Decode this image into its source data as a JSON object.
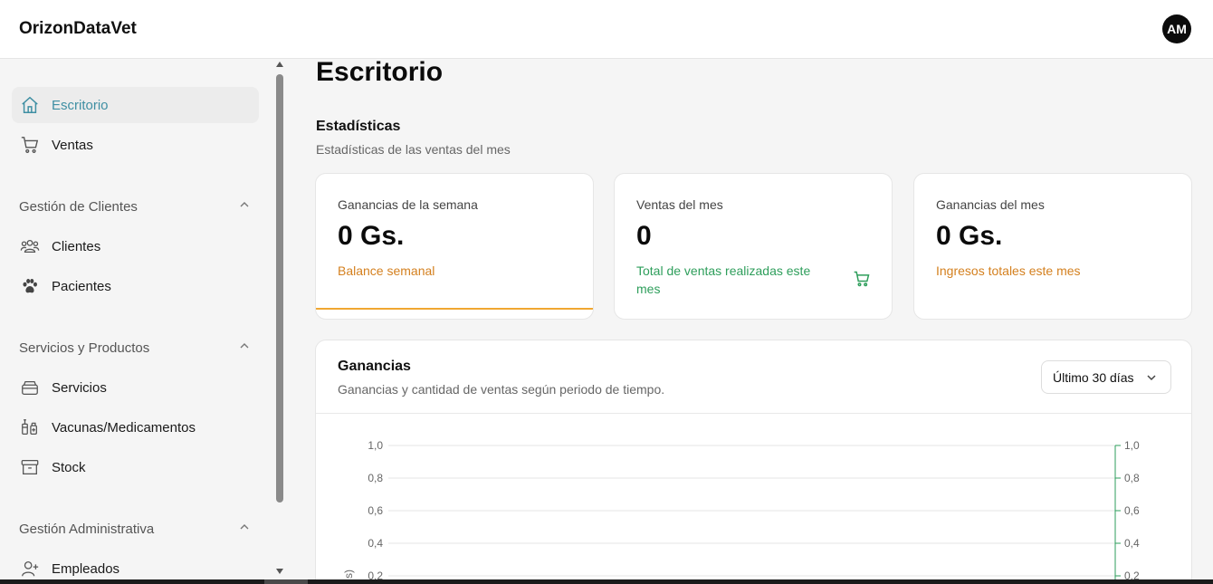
{
  "app": {
    "brand": "OrizonDataVet",
    "avatar_initials": "AM"
  },
  "sidebar": {
    "items": [
      {
        "label": "Escritorio",
        "icon": "home-icon",
        "active": true
      },
      {
        "label": "Ventas",
        "icon": "cart-icon"
      }
    ],
    "groups": [
      {
        "label": "Gestión de Clientes",
        "items": [
          {
            "label": "Clientes",
            "icon": "users-icon"
          },
          {
            "label": "Pacientes",
            "icon": "paw-icon"
          }
        ]
      },
      {
        "label": "Servicios y Productos",
        "items": [
          {
            "label": "Servicios",
            "icon": "services-icon"
          },
          {
            "label": "Vacunas/Medicamentos",
            "icon": "syringe-icon"
          },
          {
            "label": "Stock",
            "icon": "archive-icon"
          }
        ]
      },
      {
        "label": "Gestión Administrativa",
        "items": [
          {
            "label": "Empleados",
            "icon": "user-plus-icon"
          }
        ]
      }
    ]
  },
  "main": {
    "title": "Escritorio",
    "stats_title": "Estadísticas",
    "stats_subtitle": "Estadísticas de las ventas del mes",
    "cards": [
      {
        "title": "Ganancias de la semana",
        "value": "0 Gs.",
        "footer": "Balance semanal",
        "footer_color": "#d4801f",
        "accent": "#f0a732"
      },
      {
        "title": "Ventas del mes",
        "value": "0",
        "footer": "Total de ventas realizadas este mes",
        "footer_color": "#2e9e5b",
        "icon": "cart-icon"
      },
      {
        "title": "Ganancias del mes",
        "value": "0 Gs.",
        "footer": "Ingresos totales este mes",
        "footer_color": "#d4801f"
      }
    ],
    "panel": {
      "title": "Ganancias",
      "subtitle": "Ganancias y cantidad de ventas según periodo de tiempo.",
      "select_value": "Último 30 días"
    }
  },
  "chart_data": {
    "type": "line",
    "y_ticks_left": [
      "1,0",
      "0,8",
      "0,6",
      "0,4",
      "0,2"
    ],
    "y_ticks_right": [
      "1,0",
      "0,8",
      "0,6",
      "0,4",
      "0,2"
    ],
    "ylim": [
      0,
      1
    ],
    "ylabel_partial": "s)",
    "series": [],
    "right_axis_color": "#2e9e5b",
    "grid": true
  }
}
